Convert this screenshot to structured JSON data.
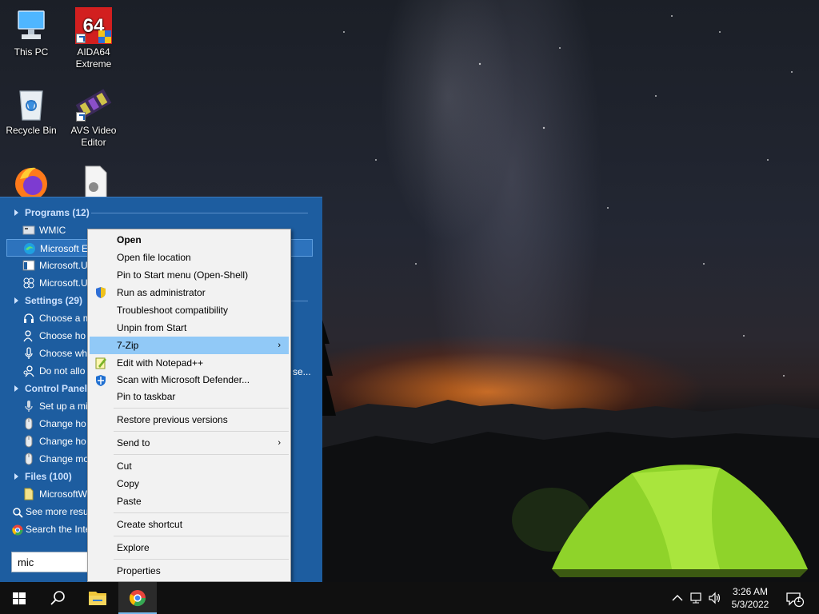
{
  "desktop": {
    "icons": [
      {
        "name": "this-pc",
        "label": "This PC"
      },
      {
        "name": "aida64",
        "label": "AIDA64 Extreme",
        "badge": "64"
      },
      {
        "name": "recycle-bin",
        "label": "Recycle Bin"
      },
      {
        "name": "avs-video-editor",
        "label": "AVS Video Editor"
      }
    ]
  },
  "start_menu": {
    "programs": {
      "label": "Programs (12)",
      "items": [
        "WMIC",
        "Microsoft E",
        "Microsoft.U",
        "Microsoft.U"
      ]
    },
    "settings": {
      "label": "Settings (29)",
      "items": [
        "Choose a m",
        "Choose ho",
        "Choose wh",
        "Do not allo"
      ]
    },
    "settings_truncated": "se...",
    "control_panel": {
      "label": "Control Panel",
      "items": [
        "Set up a mi",
        "Change ho",
        "Change ho",
        "Change mo"
      ]
    },
    "files": {
      "label": "Files (100)",
      "items": [
        "MicrosoftW"
      ]
    },
    "see_more": "See more resul",
    "search_internet": "Search the Inte",
    "search_value": "mic"
  },
  "context_menu": {
    "items": [
      {
        "label": "Open",
        "bold": true
      },
      {
        "label": "Open file location"
      },
      {
        "label": "Pin to Start menu (Open-Shell)"
      },
      {
        "label": "Run as administrator",
        "icon": "shield-icon"
      },
      {
        "label": "Troubleshoot compatibility"
      },
      {
        "label": "Unpin from Start"
      },
      {
        "label": "7-Zip",
        "submenu": true,
        "highlighted": true
      },
      {
        "label": "Edit with Notepad++",
        "icon": "notepadpp-icon"
      },
      {
        "label": "Scan with Microsoft Defender...",
        "icon": "defender-icon"
      },
      {
        "label": "Pin to taskbar"
      },
      {
        "separator": true
      },
      {
        "label": "Restore previous versions"
      },
      {
        "separator": true
      },
      {
        "label": "Send to",
        "submenu": true
      },
      {
        "separator": true
      },
      {
        "label": "Cut"
      },
      {
        "label": "Copy"
      },
      {
        "label": "Paste"
      },
      {
        "separator": true
      },
      {
        "label": "Create shortcut"
      },
      {
        "separator": true
      },
      {
        "label": "Explore"
      },
      {
        "separator": true
      },
      {
        "label": "Properties"
      }
    ]
  },
  "taskbar": {
    "time": "3:26 AM",
    "date": "5/3/2022",
    "notification_count": "1"
  },
  "colors": {
    "start_menu_bg": "#1d5da0",
    "highlight": "#91c9f7",
    "taskbar_bg": "#101010"
  }
}
